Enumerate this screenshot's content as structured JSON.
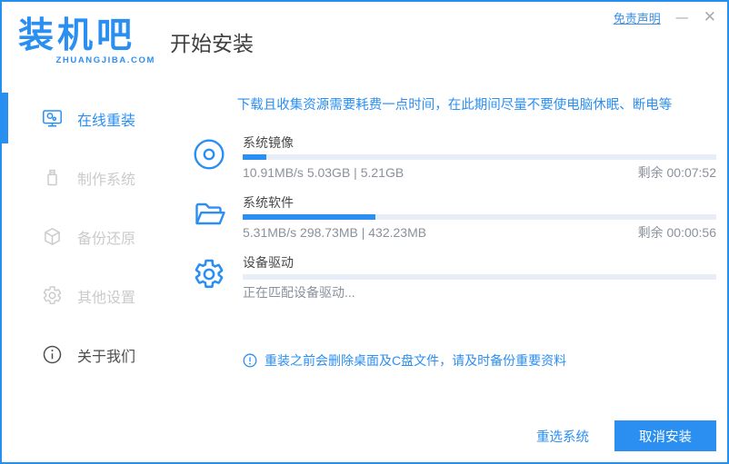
{
  "window": {
    "logo": {
      "brand": "装机吧",
      "domain": "ZHUANGJIBA.COM"
    },
    "title": "开始安装",
    "titlebar": {
      "disclaimer": "免责声明",
      "minimize": "—",
      "close": "✕"
    }
  },
  "sidebar": {
    "items": [
      {
        "label": "在线重装",
        "icon": "monitor-icon",
        "state": "active"
      },
      {
        "label": "制作系统",
        "icon": "usb-icon",
        "state": "disabled"
      },
      {
        "label": "备份还原",
        "icon": "backup-box-icon",
        "state": "disabled"
      },
      {
        "label": "其他设置",
        "icon": "gear-icon",
        "state": "disabled"
      },
      {
        "label": "关于我们",
        "icon": "info-icon",
        "state": "normal"
      }
    ]
  },
  "main": {
    "notice": "下载且收集资源需要耗费一点时间，在此期间尽量不要使电脑休眠、断电等",
    "tasks": [
      {
        "name": "系统镜像",
        "icon": "disc-icon",
        "progress_percent": 5,
        "stats": "10.91MB/s 5.03GB | 5.21GB",
        "remaining": "剩余 00:07:52"
      },
      {
        "name": "系统软件",
        "icon": "folder-icon",
        "progress_percent": 28,
        "stats": "5.31MB/s 298.73MB | 432.23MB",
        "remaining": "剩余 00:00:56"
      },
      {
        "name": "设备驱动",
        "icon": "gear-icon",
        "progress_percent": 0,
        "stats": "正在匹配设备驱动...",
        "remaining": ""
      }
    ],
    "warning": "重装之前会删除桌面及C盘文件，请及时备份重要资料",
    "footer": {
      "reselect_label": "重选系统",
      "cancel_label": "取消安装"
    }
  },
  "colors": {
    "accent": "#2b8ff2",
    "window_border": "#2491f0",
    "progress_track": "#e8eef8",
    "meta_text": "#8b919c",
    "disabled_text": "#cbcbcb"
  }
}
